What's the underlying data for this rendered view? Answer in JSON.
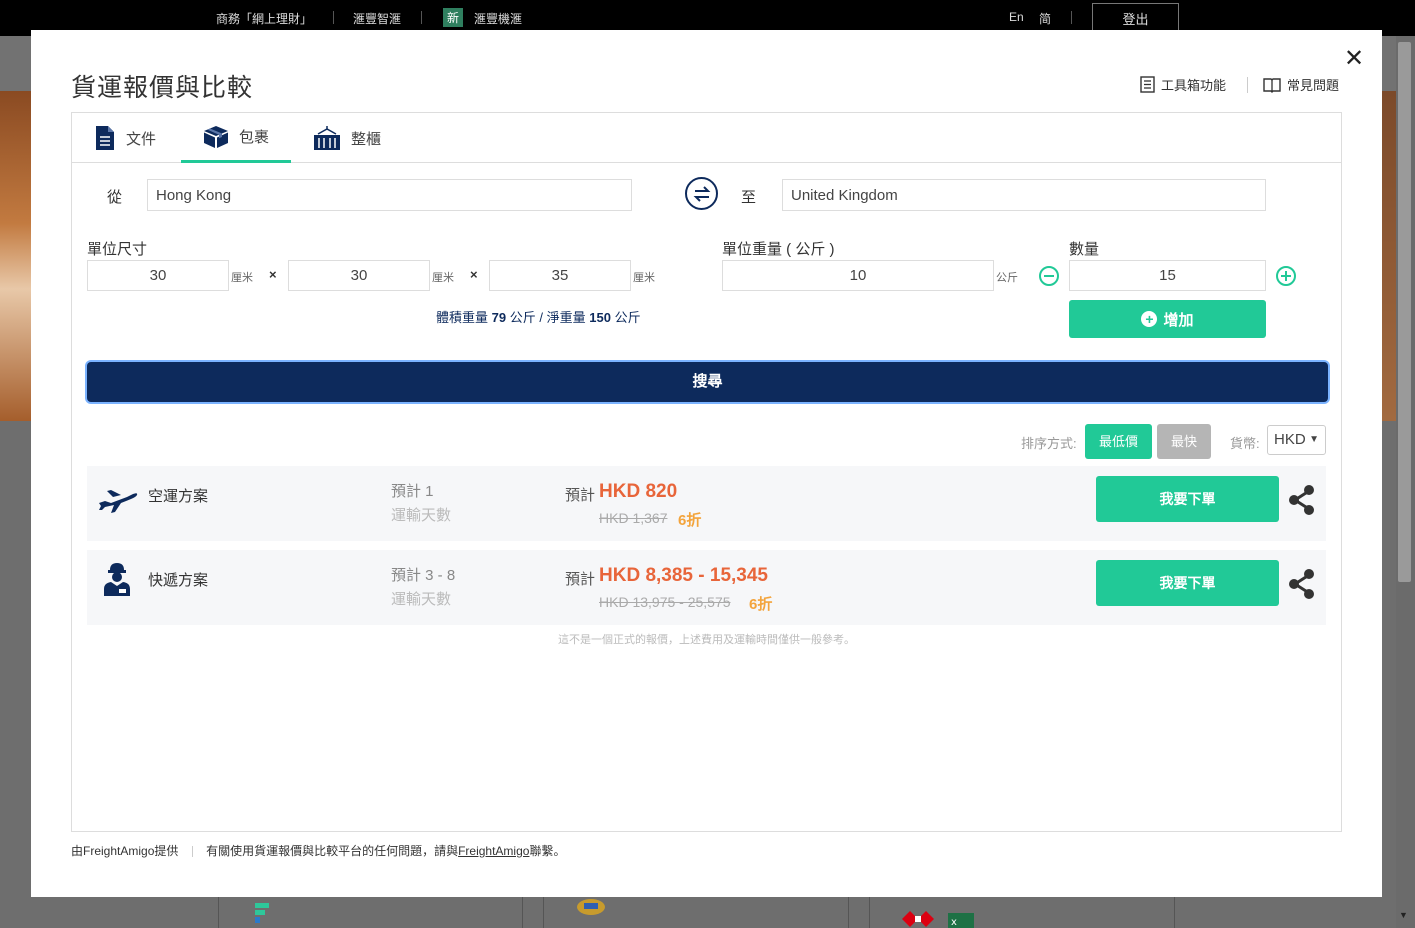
{
  "topbar": {
    "links": [
      "商務「網上理財」",
      "滙豐智滙",
      "滙豐機滙"
    ],
    "new_badge": "新",
    "lang_en": "En",
    "lang_sc": "简",
    "logout": "登出"
  },
  "modal": {
    "title": "貨運報價與比較",
    "toolbox_link": "工具箱功能",
    "faq_link": "常見問題",
    "close_symbol": "✕"
  },
  "tabs": [
    {
      "label": "文件",
      "active": false
    },
    {
      "label": "包裹",
      "active": true
    },
    {
      "label": "整櫃",
      "active": false
    }
  ],
  "form": {
    "from_label": "從",
    "from_value": "Hong Kong",
    "to_label": "至",
    "to_value": "United Kingdom",
    "dimensions_label": "單位尺寸",
    "length": "30",
    "width": "30",
    "height": "35",
    "dim_unit": "厘米",
    "times": "×",
    "weight_label": "單位重量 ( 公斤 )",
    "weight_value": "10",
    "weight_unit": "公斤",
    "quantity_label": "數量",
    "quantity_value": "15",
    "add_label": "增加",
    "summary": {
      "vol_label": "體積重量",
      "vol_value": "79",
      "vol_unit": "公斤 /",
      "net_label": "淨重量",
      "net_value": "150",
      "net_unit": "公斤"
    },
    "search_label": "搜尋"
  },
  "results_toolbar": {
    "sort_label": "排序方式:",
    "sort_cheapest": "最低價",
    "sort_fastest": "最快",
    "currency_label": "貨幣:",
    "currency_value": "HKD"
  },
  "results": [
    {
      "name": "空運方案",
      "icon": "airplane-icon",
      "est_days": "預計 1",
      "days_label": "運輸天數",
      "price_prefix": "預計",
      "price": "HKD 820",
      "old_price": "HKD 1,367",
      "discount": "6折",
      "order_label": "我要下單"
    },
    {
      "name": "快遞方案",
      "icon": "courier-icon",
      "est_days": "預計 3 - 8",
      "days_label": "運輸天數",
      "price_prefix": "預計",
      "price": "HKD 8,385 - 15,345",
      "old_price": "HKD 13,975 - 25,575",
      "discount": "6折",
      "order_label": "我要下單"
    }
  ],
  "disclaimer": "這不是一個正式的報價，上述費用及運輸時間僅供一般參考。",
  "footer": {
    "provided_by": "由FreightAmigo提供",
    "contact_prefix": "有關使用貨運報價與比較平台的任何問題，請與",
    "contact_link": "FreightAmigo",
    "contact_suffix": "聯繫。"
  },
  "colors": {
    "accent": "#21c997",
    "navy": "#0d2a5c",
    "price": "#e8653a",
    "discount": "#f3a43c"
  }
}
